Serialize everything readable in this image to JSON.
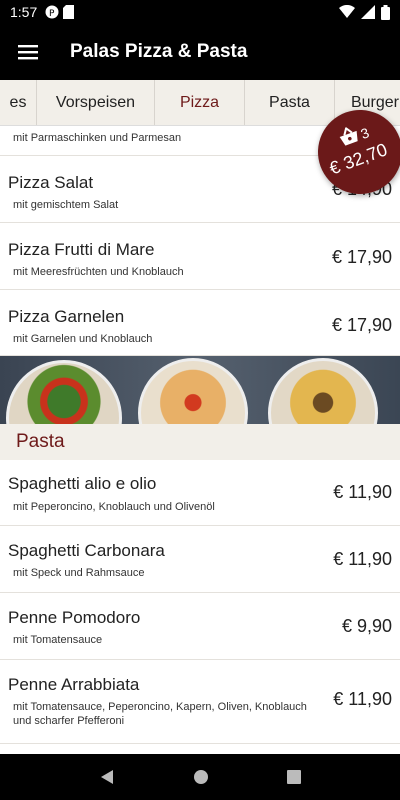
{
  "status": {
    "time": "1:57"
  },
  "header": {
    "title": "Palas Pizza & Pasta",
    "menu_icon": "hamburger-menu-icon"
  },
  "tabs": [
    {
      "label": "es"
    },
    {
      "label": "Vorspeisen"
    },
    {
      "label": "Pizza",
      "active": true
    },
    {
      "label": "Pasta"
    },
    {
      "label": "Burger"
    }
  ],
  "items": [
    {
      "name": "",
      "desc": "mit Parmaschinken und Parmesan",
      "price": ""
    },
    {
      "name": "Pizza Salat",
      "desc": "mit gemischtem Salat",
      "price": "€ 14,90"
    },
    {
      "name": "Pizza Frutti di Mare",
      "desc": "mit Meeresfrüchten und Knoblauch",
      "price": "€ 17,90"
    },
    {
      "name": "Pizza Garnelen",
      "desc": "mit Garnelen und Knoblauch",
      "price": "€ 17,90"
    }
  ],
  "pasta_section": {
    "title": "Pasta"
  },
  "pasta_items": [
    {
      "name": "Spaghetti alio e olio",
      "desc": "mit Peperoncino, Knoblauch und Olivenöl",
      "price": "€ 11,90"
    },
    {
      "name": "Spaghetti Carbonara",
      "desc": "mit Speck und Rahmsauce",
      "price": "€ 11,90"
    },
    {
      "name": "Penne Pomodoro",
      "desc": "mit Tomatensauce",
      "price": "€ 9,90"
    },
    {
      "name": "Penne Arrabbiata",
      "desc": "mit Tomatensauce, Peperoncino, Kapern, Oliven, Knoblauch und scharfer Pfefferoni",
      "price": "€ 11,90"
    }
  ],
  "cart": {
    "count": "3",
    "total": "€ 32,70",
    "icon": "shopping-basket-icon"
  },
  "colors": {
    "accent": "#6e1a1a",
    "badge": "#6b1919",
    "bar": "#000000",
    "tabs_bg": "#f2efe9"
  }
}
